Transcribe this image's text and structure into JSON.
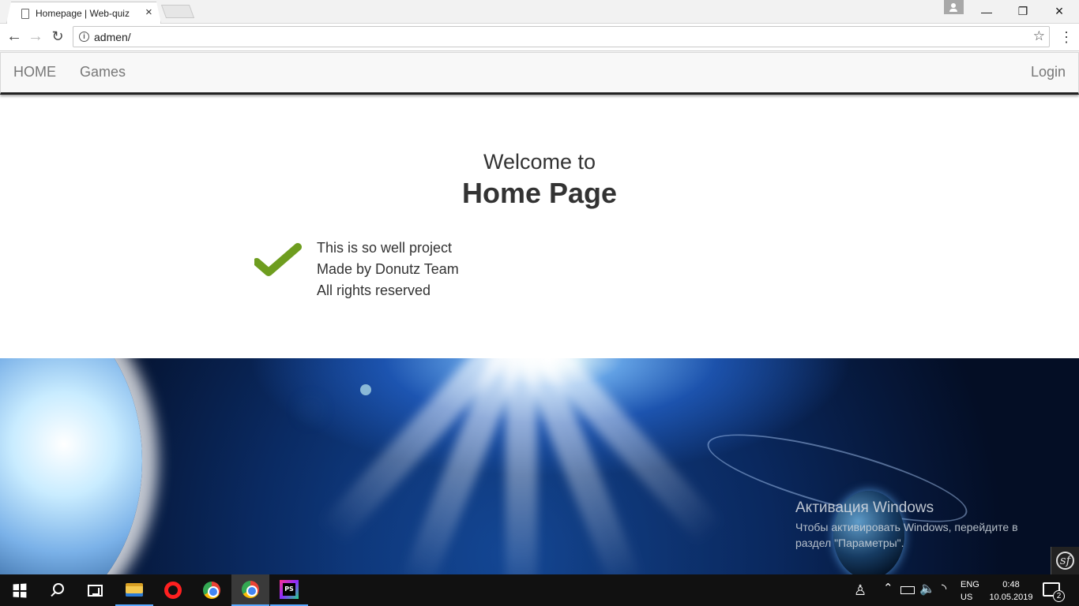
{
  "browser": {
    "tab_title": "Homepage | Web-quiz",
    "tab_close": "×",
    "url": "admen/",
    "icons": {
      "back": "←",
      "forward": "→",
      "reload": "↻",
      "star": "☆",
      "menu": "⋮",
      "minimize": "—",
      "maximize": "❐",
      "close": "×"
    }
  },
  "site": {
    "nav": {
      "home": "HOME",
      "games": "Games",
      "login": "Login"
    },
    "welcome": "Welcome to",
    "heading": "Home Page",
    "lines": [
      "This is so well project",
      "Made by Donutz Team",
      "All rights reserved"
    ],
    "accent_color": "#6e9d1f"
  },
  "windows": {
    "activation_title": "Активация Windows",
    "activation_text": "Чтобы активировать Windows, перейдите в раздел \"Параметры\".",
    "language": [
      "ENG",
      "US"
    ],
    "time": "0:48",
    "date": "10.05.2019",
    "notification_count": "2",
    "tray_icons": {
      "people": "♙",
      "up": "⌃",
      "volume": "🔈",
      "wifi": "◝"
    }
  }
}
